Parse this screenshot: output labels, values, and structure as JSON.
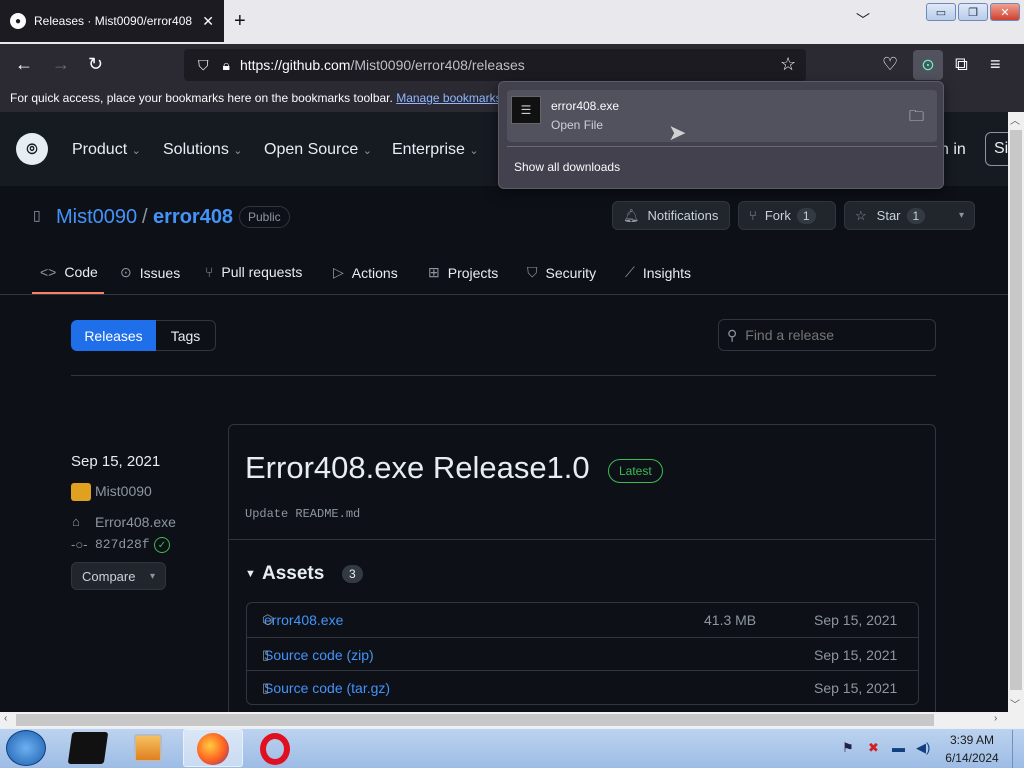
{
  "browser": {
    "tab_title": "Releases · Mist0090/error408",
    "tab_close": "✕",
    "new_tab": "+",
    "url_host": "https://github.com",
    "url_path": "/Mist0090/error408/releases",
    "bookmarks_text": "For quick access, place your bookmarks here on the bookmarks toolbar.",
    "bookmarks_link": "Manage bookmarks..."
  },
  "downloads": {
    "file_name": "error408.exe",
    "file_status": "Open File",
    "show_all": "Show all downloads"
  },
  "gh_nav": {
    "items": [
      "Product",
      "Solutions",
      "Open Source",
      "Enterprise"
    ],
    "sign_in": "n in",
    "sign_up": "Si"
  },
  "repo": {
    "owner": "Mist0090",
    "separator": "/",
    "name": "error408",
    "visibility": "Public",
    "notifications": "Notifications",
    "fork": "Fork",
    "fork_count": "1",
    "star": "Star",
    "star_count": "1"
  },
  "repo_tabs": [
    {
      "label": "Code",
      "icon": "<>"
    },
    {
      "label": "Issues",
      "icon": "⊙"
    },
    {
      "label": "Pull requests",
      "icon": "⑂"
    },
    {
      "label": "Actions",
      "icon": "▷"
    },
    {
      "label": "Projects",
      "icon": "⊞"
    },
    {
      "label": "Security",
      "icon": "⛉"
    },
    {
      "label": "Insights",
      "icon": "⟋"
    }
  ],
  "releases_toggle": {
    "releases": "Releases",
    "tags": "Tags"
  },
  "search": {
    "placeholder": "Find a release"
  },
  "release": {
    "date": "Sep 15, 2021",
    "author": "Mist0090",
    "tag": "Error408.exe",
    "commit": "827d28f",
    "compare": "Compare",
    "title": "Error408.exe Release1.0",
    "badge": "Latest",
    "body": "Update README.md",
    "assets_label": "Assets",
    "assets_count": "3",
    "assets": [
      {
        "name": "error408.exe",
        "size": "41.3 MB",
        "date": "Sep 15, 2021"
      },
      {
        "name": "Source code (zip)",
        "size": "",
        "date": "Sep 15, 2021"
      },
      {
        "name": "Source code (tar.gz)",
        "size": "",
        "date": "Sep 15, 2021"
      }
    ]
  },
  "taskbar": {
    "time": "3:39 AM",
    "date": "6/14/2024"
  },
  "colors": {
    "accent": "#1f6feb",
    "link": "#4493f8",
    "latest": "#3fb950"
  }
}
